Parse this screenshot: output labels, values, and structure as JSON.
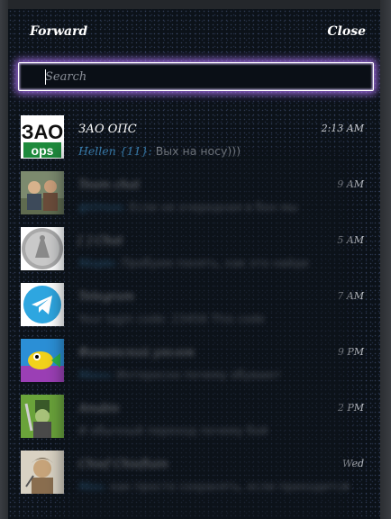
{
  "dialog": {
    "title": "Forward",
    "close_label": "Close"
  },
  "search": {
    "placeholder": "Search",
    "value": ""
  },
  "chats": [
    {
      "name": "ЗАО ОПС",
      "time": "2:13 AM",
      "sender": "Hellen {11}:",
      "text": " Вых на носу)))",
      "avatar": "zao-ops-logo",
      "blurred": false
    },
    {
      "name": "Team chat",
      "time": "9 AM",
      "sender": "@Orion:",
      "text": " Если не очередная в бон мы",
      "avatar": "group-photo",
      "blurred": true
    },
    {
      "name": "[ ] Chat",
      "time": "5 AM",
      "sender": "Maple:",
      "text": " Пробуем понять, как это найде",
      "avatar": "coin-image",
      "blurred": true
    },
    {
      "name": "Telegram",
      "time": "7 AM",
      "sender": "",
      "text": " Your login code: 23456 This code",
      "avatar": "telegram-logo",
      "blurred": true
    },
    {
      "name": "Фанатский уголок",
      "time": "9 PM",
      "sender": "Maxx:",
      "text": " Интересно почему обувают",
      "avatar": "cartoon-fish",
      "blurred": true
    },
    {
      "name": "Anubis",
      "time": "2 PM",
      "sender": "",
      "text": " И обычный переход почему бой",
      "avatar": "cartoon-knight",
      "blurred": true
    },
    {
      "name": "Chief Chieftain",
      "time": "Wed",
      "sender": "Max:",
      "text": " как просто сохранять, если приходится",
      "avatar": "drawn-portrait",
      "blurred": true
    }
  ],
  "colors": {
    "background": "#0c1219",
    "accent_glow": "#b478ff",
    "sender": "#4aa8e8",
    "preview_text": "#9aa0a8"
  }
}
